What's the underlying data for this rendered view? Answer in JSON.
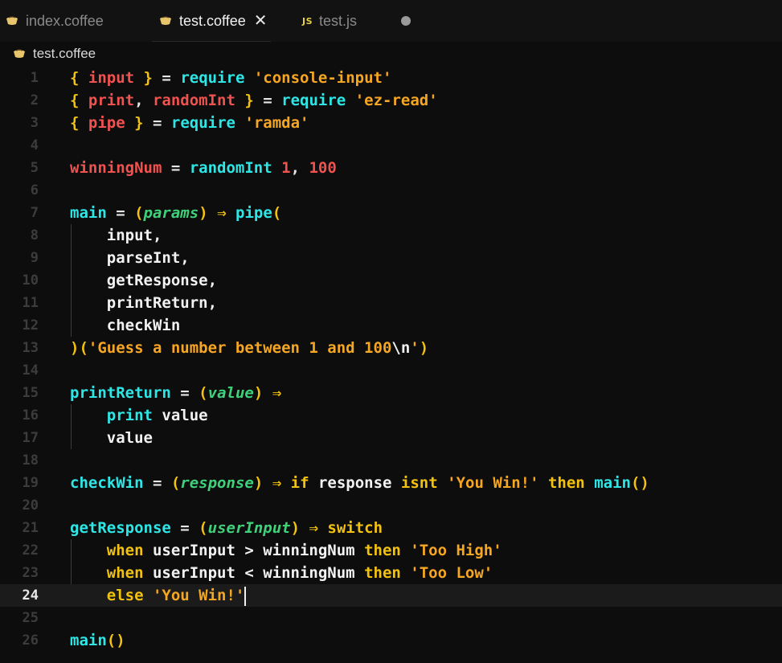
{
  "tabs": [
    {
      "label": "index.coffee",
      "icon": "coffee-icon",
      "active": false
    },
    {
      "label": "test.coffee",
      "icon": "coffee-icon",
      "active": true
    },
    {
      "label": "test.js",
      "icon": "js-icon",
      "active": false
    }
  ],
  "close_glyph": "✕",
  "js_icon_text": "JS",
  "breadcrumb": {
    "label": "test.coffee",
    "icon": "coffee-icon"
  },
  "colors": {
    "background": "#0d0d0d",
    "keyword": "#2ee6e6",
    "string": "#f5a623",
    "variable": "#f0524f",
    "bracket": "#f2c20f",
    "param": "#3fd07a",
    "plain": "#f2f2f2"
  },
  "editor": {
    "current_line": 24,
    "lines": [
      {
        "n": "1",
        "tokens": [
          [
            "bracket",
            "{ "
          ],
          [
            "var",
            "input"
          ],
          [
            "bracket",
            " }"
          ],
          [
            "op",
            " = "
          ],
          [
            "kw",
            "require"
          ],
          [
            "op",
            " "
          ],
          [
            "str",
            "'console-input'"
          ]
        ]
      },
      {
        "n": "2",
        "tokens": [
          [
            "bracket",
            "{ "
          ],
          [
            "var",
            "print"
          ],
          [
            "op",
            ", "
          ],
          [
            "var",
            "randomInt"
          ],
          [
            "bracket",
            " }"
          ],
          [
            "op",
            " = "
          ],
          [
            "kw",
            "require"
          ],
          [
            "op",
            " "
          ],
          [
            "str",
            "'ez-read'"
          ]
        ]
      },
      {
        "n": "3",
        "tokens": [
          [
            "bracket",
            "{ "
          ],
          [
            "var",
            "pipe"
          ],
          [
            "bracket",
            " }"
          ],
          [
            "op",
            " = "
          ],
          [
            "kw",
            "require"
          ],
          [
            "op",
            " "
          ],
          [
            "str",
            "'ramda'"
          ]
        ]
      },
      {
        "n": "4",
        "tokens": []
      },
      {
        "n": "5",
        "tokens": [
          [
            "var",
            "winningNum"
          ],
          [
            "op",
            " = "
          ],
          [
            "fn",
            "randomInt"
          ],
          [
            "op",
            " "
          ],
          [
            "num",
            "1"
          ],
          [
            "op",
            ", "
          ],
          [
            "num",
            "100"
          ]
        ]
      },
      {
        "n": "6",
        "tokens": []
      },
      {
        "n": "7",
        "tokens": [
          [
            "fn",
            "main"
          ],
          [
            "op",
            " = "
          ],
          [
            "bracket",
            "("
          ],
          [
            "param",
            "params"
          ],
          [
            "bracket",
            ")"
          ],
          [
            "op",
            " "
          ],
          [
            "arrow",
            "⇒"
          ],
          [
            "op",
            " "
          ],
          [
            "fn",
            "pipe"
          ],
          [
            "bracket",
            "("
          ]
        ]
      },
      {
        "n": "8",
        "indent": true,
        "tokens": [
          [
            "plain",
            "    input,"
          ]
        ]
      },
      {
        "n": "9",
        "indent": true,
        "tokens": [
          [
            "plain",
            "    parseInt,"
          ]
        ]
      },
      {
        "n": "10",
        "indent": true,
        "tokens": [
          [
            "plain",
            "    getResponse,"
          ]
        ]
      },
      {
        "n": "11",
        "indent": true,
        "tokens": [
          [
            "plain",
            "    printReturn,"
          ]
        ]
      },
      {
        "n": "12",
        "indent": true,
        "tokens": [
          [
            "plain",
            "    checkWin"
          ]
        ]
      },
      {
        "n": "13",
        "tokens": [
          [
            "bracket",
            ")("
          ],
          [
            "str",
            "'Guess a number between 1 and 100"
          ],
          [
            "esc",
            "\\n"
          ],
          [
            "str",
            "'"
          ],
          [
            "bracket",
            ")"
          ]
        ]
      },
      {
        "n": "14",
        "tokens": []
      },
      {
        "n": "15",
        "tokens": [
          [
            "fn",
            "printReturn"
          ],
          [
            "op",
            " = "
          ],
          [
            "bracket",
            "("
          ],
          [
            "param",
            "value"
          ],
          [
            "bracket",
            ")"
          ],
          [
            "op",
            " "
          ],
          [
            "arrow",
            "⇒"
          ]
        ]
      },
      {
        "n": "16",
        "indent": true,
        "tokens": [
          [
            "kw",
            "    print"
          ],
          [
            "plain",
            " value"
          ]
        ]
      },
      {
        "n": "17",
        "indent": true,
        "tokens": [
          [
            "plain",
            "    value"
          ]
        ]
      },
      {
        "n": "18",
        "tokens": []
      },
      {
        "n": "19",
        "tokens": [
          [
            "fn",
            "checkWin"
          ],
          [
            "op",
            " = "
          ],
          [
            "bracket",
            "("
          ],
          [
            "param",
            "response"
          ],
          [
            "bracket",
            ")"
          ],
          [
            "op",
            " "
          ],
          [
            "arrow",
            "⇒"
          ],
          [
            "op",
            " "
          ],
          [
            "ctrl",
            "if"
          ],
          [
            "plain",
            " response "
          ],
          [
            "ctrl",
            "isnt"
          ],
          [
            "op",
            " "
          ],
          [
            "str",
            "'You Win!'"
          ],
          [
            "op",
            " "
          ],
          [
            "ctrl",
            "then"
          ],
          [
            "op",
            " "
          ],
          [
            "fn",
            "main"
          ],
          [
            "bracket",
            "()"
          ]
        ]
      },
      {
        "n": "20",
        "tokens": []
      },
      {
        "n": "21",
        "tokens": [
          [
            "fn",
            "getResponse"
          ],
          [
            "op",
            " = "
          ],
          [
            "bracket",
            "("
          ],
          [
            "param",
            "userInput"
          ],
          [
            "bracket",
            ")"
          ],
          [
            "op",
            " "
          ],
          [
            "arrow",
            "⇒"
          ],
          [
            "op",
            " "
          ],
          [
            "ctrl",
            "switch"
          ]
        ]
      },
      {
        "n": "22",
        "indent": true,
        "tokens": [
          [
            "ctrl",
            "    when"
          ],
          [
            "plain",
            " userInput > winningNum "
          ],
          [
            "ctrl",
            "then"
          ],
          [
            "op",
            " "
          ],
          [
            "str",
            "'Too High'"
          ]
        ]
      },
      {
        "n": "23",
        "indent": true,
        "tokens": [
          [
            "ctrl",
            "    when"
          ],
          [
            "plain",
            " userInput < winningNum "
          ],
          [
            "ctrl",
            "then"
          ],
          [
            "op",
            " "
          ],
          [
            "str",
            "'Too Low'"
          ]
        ]
      },
      {
        "n": "24",
        "indent": true,
        "cursor": true,
        "tokens": [
          [
            "ctrl",
            "    else"
          ],
          [
            "op",
            " "
          ],
          [
            "str",
            "'You Win!'"
          ]
        ]
      },
      {
        "n": "25",
        "tokens": []
      },
      {
        "n": "26",
        "tokens": [
          [
            "fn",
            "main"
          ],
          [
            "bracket",
            "()"
          ]
        ]
      }
    ]
  }
}
